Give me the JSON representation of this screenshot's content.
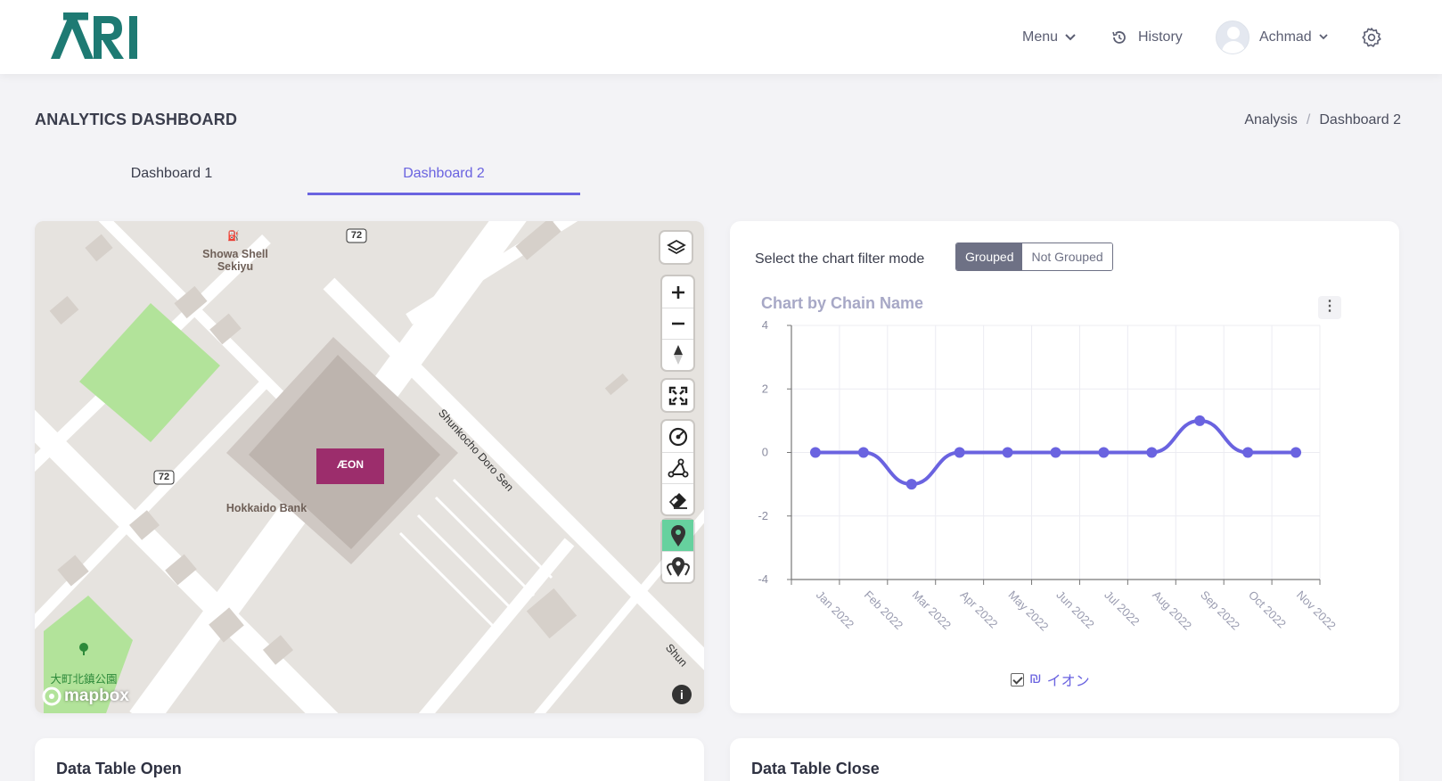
{
  "header": {
    "logo_text": "ARI",
    "menu_label": "Menu",
    "history_label": "History",
    "user_name": "Achmad"
  },
  "page": {
    "title": "ANALYTICS DASHBOARD",
    "breadcrumb": [
      "Analysis",
      "Dashboard 2"
    ],
    "breadcrumb_sep": "/"
  },
  "tabs": [
    {
      "label": "Dashboard 1",
      "active": false
    },
    {
      "label": "Dashboard 2",
      "active": true
    }
  ],
  "map": {
    "labels": {
      "station": "Showa Shell Sekiyu",
      "bank": "Hokkaido Bank",
      "road": "Shunkocho Doro Sen",
      "road_cut": "Shun",
      "route": "72",
      "park": "大町北鎮公園",
      "store": "ÆON"
    },
    "attribution": "mapbox",
    "info": "i"
  },
  "chart": {
    "filter_label": "Select the chart filter mode",
    "mode_grouped": "Grouped",
    "mode_not_grouped": "Not Grouped",
    "title": "Chart by Chain Name",
    "menu_icon": "⋮",
    "legend_icon": "₪",
    "legend_label": "イオン"
  },
  "chart_data": {
    "type": "line",
    "title": "Chart by Chain Name",
    "categories": [
      "Jan 2022",
      "Feb 2022",
      "Mar 2022",
      "Apr 2022",
      "May 2022",
      "Jun 2022",
      "Jul 2022",
      "Aug 2022",
      "Sep 2022",
      "Oct 2022",
      "Nov 2022"
    ],
    "series": [
      {
        "name": "イオン",
        "values": [
          0,
          0,
          -1,
          0,
          0,
          0,
          0,
          0,
          1,
          0,
          0
        ],
        "color": "#6a63e0"
      }
    ],
    "yticks": [
      4,
      2,
      0,
      -2,
      -4
    ],
    "ylim": [
      -4,
      4
    ],
    "grid": true,
    "legend": "bottom-center"
  },
  "tables": {
    "open_title": "Data Table Open",
    "close_title": "Data Table Close"
  },
  "colors": {
    "accent": "#6a63e0",
    "logo": "#1e7a73",
    "active_map_tool": "#66d19e"
  }
}
